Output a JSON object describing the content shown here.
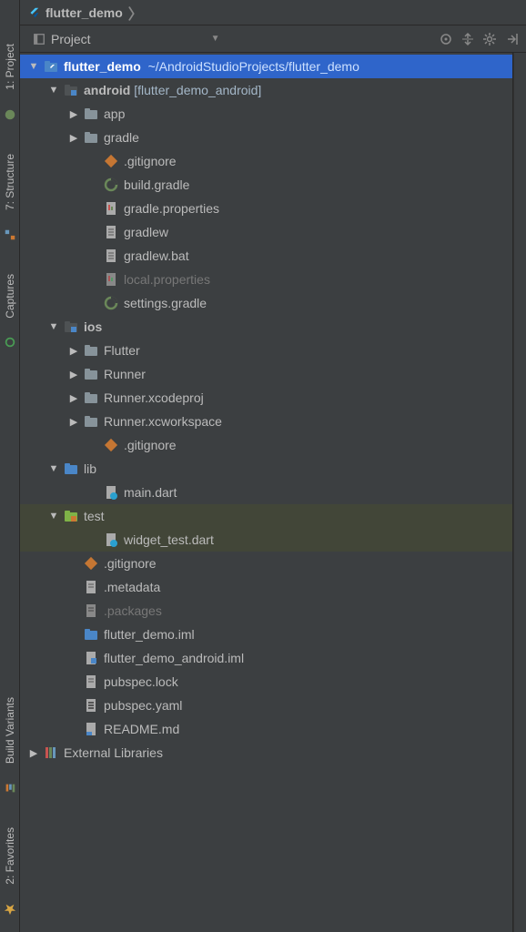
{
  "breadcrumb": {
    "project_name": "flutter_demo"
  },
  "toolbar": {
    "view_label": "Project"
  },
  "gutter_tabs": {
    "project": "1: Project",
    "structure": "7: Structure",
    "captures": "Captures",
    "build_variants": "Build Variants",
    "favorites": "2: Favorites"
  },
  "tree": {
    "root_name": "flutter_demo",
    "root_path": "~/AndroidStudioProjects/flutter_demo",
    "android": {
      "name": "android",
      "module": "[flutter_demo_android]"
    },
    "android_children": {
      "app": "app",
      "gradle": "gradle",
      "gitignore": ".gitignore",
      "build_gradle": "build.gradle",
      "gradle_properties": "gradle.properties",
      "gradlew": "gradlew",
      "gradlew_bat": "gradlew.bat",
      "local_properties": "local.properties",
      "settings_gradle": "settings.gradle"
    },
    "ios": {
      "name": "ios"
    },
    "ios_children": {
      "flutter": "Flutter",
      "runner": "Runner",
      "runner_xcodeproj": "Runner.xcodeproj",
      "runner_xcworkspace": "Runner.xcworkspace",
      "gitignore": ".gitignore"
    },
    "lib": {
      "name": "lib"
    },
    "lib_children": {
      "main_dart": "main.dart"
    },
    "test": {
      "name": "test"
    },
    "test_children": {
      "widget_test": "widget_test.dart"
    },
    "root_files": {
      "gitignore": ".gitignore",
      "metadata": ".metadata",
      "packages": ".packages",
      "flutter_demo_iml": "flutter_demo.iml",
      "flutter_demo_android_iml": "flutter_demo_android.iml",
      "pubspec_lock": "pubspec.lock",
      "pubspec_yaml": "pubspec.yaml",
      "readme": "README.md"
    },
    "external_libraries": "External Libraries"
  }
}
